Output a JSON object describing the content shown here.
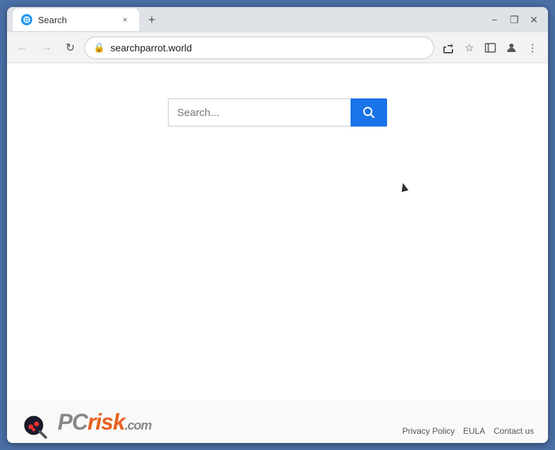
{
  "browser": {
    "tab": {
      "title": "Search",
      "favicon_color": "#2196F3",
      "close_label": "×"
    },
    "new_tab_label": "+",
    "window_controls": {
      "minimize": "−",
      "restore": "❐",
      "close": "✕"
    },
    "nav": {
      "back_label": "←",
      "forward_label": "→",
      "reload_label": "↻",
      "address": "searchparrot.world",
      "lock_icon": "🔒"
    },
    "nav_actions": {
      "share": "⬆",
      "bookmark": "☆",
      "sidebar": "▭",
      "profile": "👤",
      "menu": "⋮"
    }
  },
  "page": {
    "search": {
      "placeholder": "Search...",
      "button_icon": "🔍"
    },
    "footer": {
      "logo_pc": "PC",
      "logo_risk": "risk",
      "logo_com": ".com",
      "links": [
        {
          "label": "Privacy Policy"
        },
        {
          "label": "EULA"
        },
        {
          "label": "Contact us"
        }
      ]
    }
  }
}
